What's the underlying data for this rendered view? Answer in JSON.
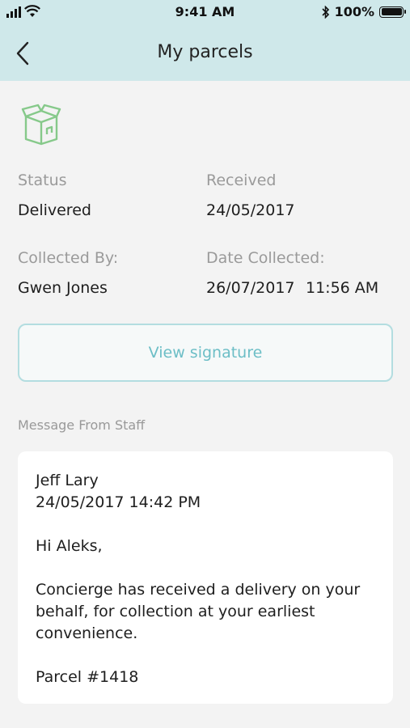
{
  "status_bar": {
    "time": "9:41 AM",
    "battery_text": "100%"
  },
  "header": {
    "title": "My parcels"
  },
  "parcel": {
    "status_label": "Status",
    "status_value": "Delivered",
    "received_label": "Received",
    "received_value": "24/05/2017",
    "collected_by_label": "Collected By:",
    "collected_by_value": "Gwen Jones",
    "date_collected_label": "Date Collected:",
    "date_collected_value": "26/07/2017",
    "time_collected_value": "11:56 AM"
  },
  "signature_button": "View signature",
  "message": {
    "section_label": "Message From Staff",
    "author": "Jeff Lary",
    "datetime": "24/05/2017 14:42 PM",
    "greeting": "Hi Aleks,",
    "body_lines": [
      "Concierge has received a delivery on your",
      "behalf, for collection at your earliest",
      "convenience."
    ],
    "parcel_ref": "Parcel #1418"
  },
  "colors": {
    "header_bg": "#cfe8ea",
    "accent": "#6cbec6",
    "icon_green": "#86c98a"
  },
  "icons": [
    "signal-icon",
    "wifi-icon",
    "bluetooth-icon",
    "battery-icon",
    "back-chevron-icon",
    "parcel-box-icon"
  ]
}
